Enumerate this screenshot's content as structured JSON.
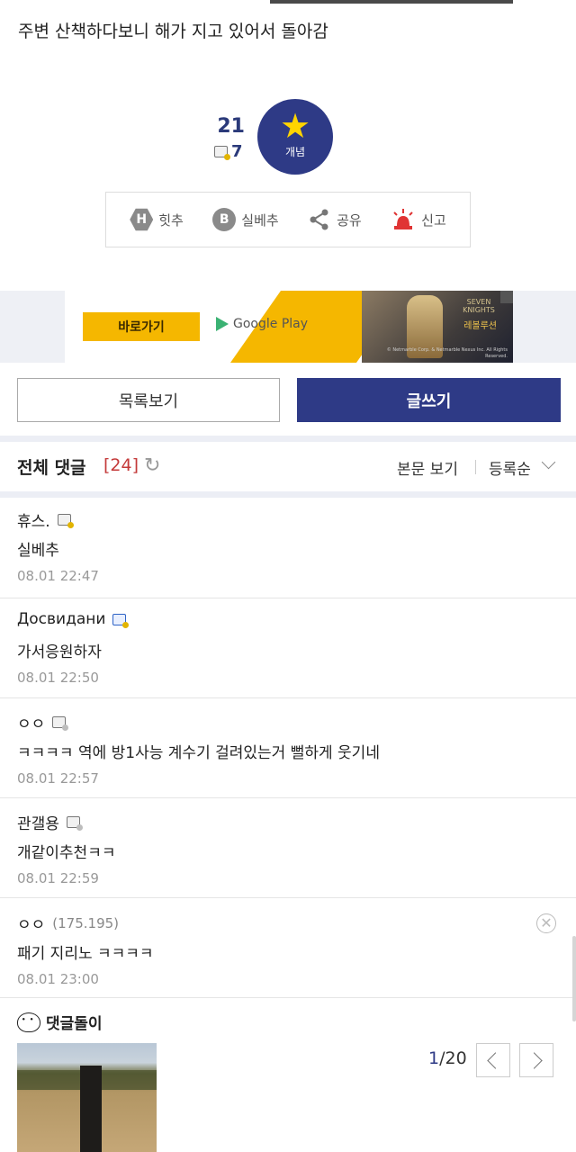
{
  "post": {
    "text": "주변 산책하다보니 해가 지고 있어서 돌아감"
  },
  "recommend": {
    "count": "21",
    "sub_count": "7",
    "button_label": "개념"
  },
  "actions": [
    {
      "icon": "H",
      "label": "힛추"
    },
    {
      "icon": "B",
      "label": "실베추"
    },
    {
      "icon": "share",
      "label": "공유"
    },
    {
      "icon": "siren",
      "label": "신고"
    }
  ],
  "ad": {
    "button_label": "바로가기",
    "store_label": "Google Play",
    "game_logo_top": "SEVEN KNIGHTS",
    "game_logo_bottom": "레볼루션",
    "copyright": "© Netmarble Corp. & Netmarble Nexus Inc. All Rights Reserved."
  },
  "buttons": {
    "list": "목록보기",
    "write": "글쓰기"
  },
  "comments_header": {
    "title": "전체 댓글",
    "count": "[24]",
    "view_body": "본문 보기",
    "sort": "등록순"
  },
  "comments": [
    {
      "nick": "휴스.",
      "ip": "",
      "text": "실베추",
      "time": "08.01 22:47",
      "badge": "gold"
    },
    {
      "nick": "Досвидани",
      "ip": "",
      "text": "가서응원하자",
      "time": "08.01 22:50",
      "badge": "blue"
    },
    {
      "nick": "ㅇㅇ",
      "ip": "",
      "text": "ㅋㅋㅋㅋ 역에 방1사능 계수기 걸려있는거 뻘하게 웃기네",
      "time": "08.01 22:57",
      "badge": "gray"
    },
    {
      "nick": "관갤용",
      "ip": "",
      "text": "개같이추천ㅋㅋ",
      "time": "08.01 22:59",
      "badge": "gray"
    },
    {
      "nick": "ㅇㅇ",
      "ip": "(175.195)",
      "text": "패기 지리노 ㅋㅋㅋㅋ",
      "time": "08.01 23:00",
      "badge": ""
    }
  ],
  "bot": {
    "title": "댓글돌이",
    "page_current": "1",
    "page_total": "/20"
  },
  "colors": {
    "accent": "#2e3a86",
    "count_red": "#c43a3a",
    "ad_yellow": "#f5b700"
  }
}
